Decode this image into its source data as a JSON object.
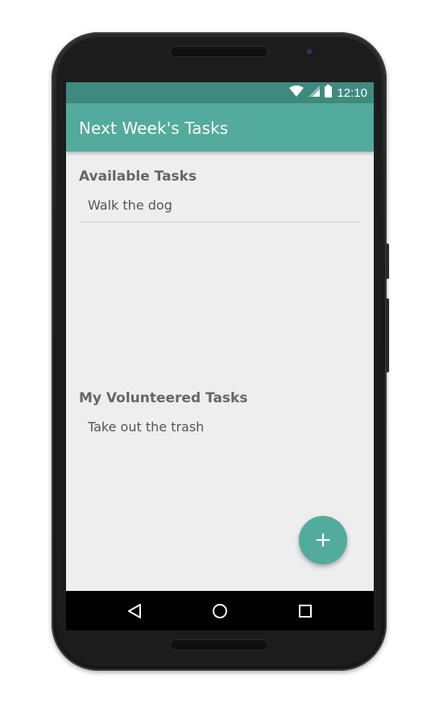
{
  "status_bar": {
    "time": "12:10",
    "icons": [
      "wifi-icon",
      "cell-signal-icon",
      "battery-icon"
    ]
  },
  "app_bar": {
    "title": "Next Week's Tasks"
  },
  "sections": {
    "available": {
      "title": "Available Tasks",
      "items": [
        {
          "label": "Walk the dog"
        }
      ]
    },
    "volunteered": {
      "title": "My Volunteered Tasks",
      "items": [
        {
          "label": "Take out the trash"
        }
      ]
    }
  },
  "fab": {
    "label": "+",
    "icon": "add-icon"
  },
  "nav_bar": {
    "buttons": [
      "back-icon",
      "home-icon",
      "recents-icon"
    ]
  },
  "colors": {
    "primary": "#52ab9c",
    "primary_dark": "#3f8a7f",
    "background": "#eeeeee",
    "header_text": "#666666",
    "item_text": "#555555"
  }
}
